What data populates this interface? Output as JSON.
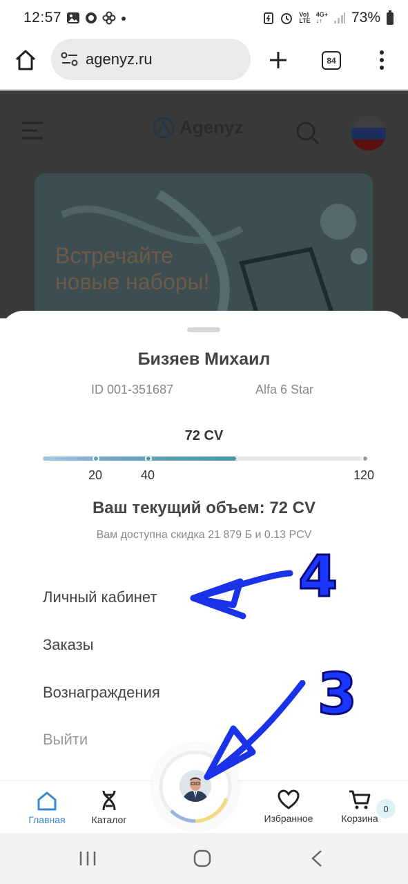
{
  "status_bar": {
    "time": "12:57",
    "battery": "73%",
    "network_top": "Vo)",
    "network_bottom": "LTE",
    "gen": "4G+"
  },
  "browser": {
    "url": "agenyz.ru",
    "tab_count": "84"
  },
  "site": {
    "logo": "Agenyz",
    "banner_text": "Встречайте новые наборы!"
  },
  "profile": {
    "name": "Бизяев Михаил",
    "id": "ID 001-351687",
    "rank": "Alfa 6 Star",
    "cv": "72 CV",
    "progress": {
      "current": 72,
      "max": 120,
      "ticks": [
        "20",
        "40",
        "120"
      ]
    },
    "current_volume": "Ваш текущий объем: 72 CV",
    "discount": "Вам доступна скидка 21 879 Б и 0.13 PCV"
  },
  "menu": {
    "cabinet": "Личный кабинет",
    "orders": "Заказы",
    "rewards": "Вознаграждения",
    "logout": "Выйти"
  },
  "bottom_nav": {
    "home": "Главная",
    "catalog": "Каталог",
    "favorites": "Избранное",
    "cart": "Корзина",
    "cart_count": "0"
  },
  "annotations": {
    "step_a": "4",
    "step_b": "3"
  },
  "colors": {
    "accent": "#3a86c8",
    "progress_end": "#3f9a9e",
    "annotation": "#1a36ff"
  }
}
